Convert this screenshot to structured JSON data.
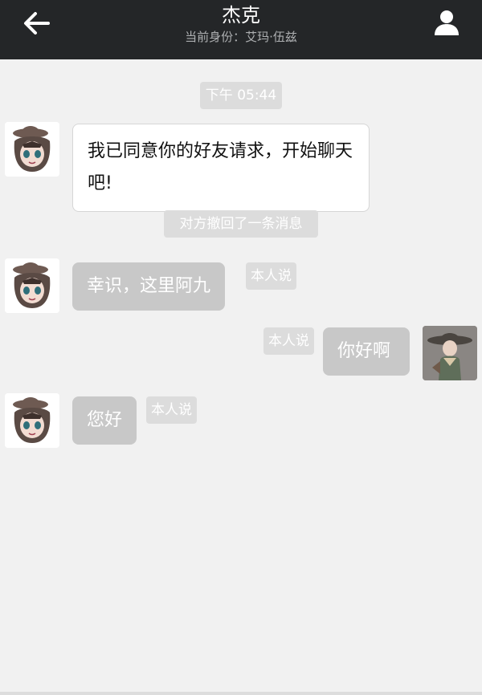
{
  "header": {
    "title": "杰克",
    "subtitle": "当前身份：艾玛·伍兹",
    "back_icon": "arrow-left-icon",
    "profile_icon": "user-icon"
  },
  "chat": {
    "time_label": "下午 05:44",
    "messages": [
      {
        "sender": "contact",
        "avatar": "contact-avatar",
        "text": "我已同意你的好友请求，开始聊天吧!"
      },
      {
        "system": "对方撤回了一条消息"
      },
      {
        "sender": "contact",
        "avatar": "contact-avatar",
        "text": "幸识，这里阿九",
        "tag": "本人说"
      },
      {
        "sender": "self",
        "avatar": "self-avatar",
        "text": "你好啊",
        "tag": "本人说"
      },
      {
        "sender": "contact",
        "avatar": "contact-avatar",
        "text": "您好",
        "tag": "本人说"
      }
    ]
  },
  "colors": {
    "header_bg": "#242628",
    "chat_bg": "#f1f1f1",
    "gray_bubble": "#c8c8c8",
    "tag_bg": "#dcdcdc"
  }
}
